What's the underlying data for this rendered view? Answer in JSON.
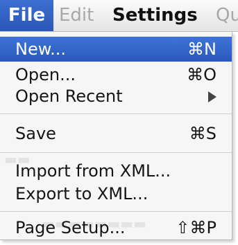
{
  "menubar": {
    "items": [
      {
        "label": "File"
      },
      {
        "label": "Edit"
      },
      {
        "label": "Settings"
      },
      {
        "label": "Qu"
      }
    ]
  },
  "file_menu": {
    "items": [
      {
        "label": "New...",
        "shortcut": "⌘N"
      },
      {
        "label": "Open...",
        "shortcut": "⌘O"
      },
      {
        "label": "Open Recent"
      },
      {
        "label": "Save",
        "shortcut": "⌘S"
      },
      {
        "label": "Import from XML..."
      },
      {
        "label": "Export to XML..."
      },
      {
        "label": "Page Setup...",
        "shortcut": "⇧⌘P"
      }
    ]
  },
  "colors": {
    "highlight": "#2f62c8",
    "disabled_text": "#a8a8a8"
  }
}
